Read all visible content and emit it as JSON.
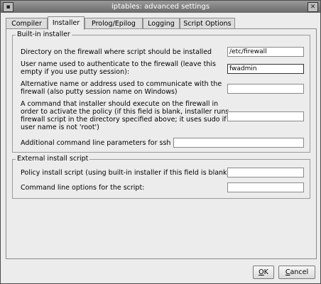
{
  "window": {
    "title": "iptables: advanced settings",
    "menu_icon": "▪",
    "close_icon": "✕"
  },
  "tabs": [
    {
      "label": "Compiler"
    },
    {
      "label": "Installer"
    },
    {
      "label": "Prolog/Epilog"
    },
    {
      "label": "Logging"
    },
    {
      "label": "Script Options"
    }
  ],
  "builtin": {
    "title": "Built-in installer",
    "dir_label": "Directory on the firewall where script should be installed",
    "dir_value": "/etc/firewall",
    "user_label_1": "User name used to authenticate to the firewall (leave this",
    "user_label_2": "empty if you use putty session):",
    "user_value": "fwadmin",
    "alt_label_1": "Alternative name or address used to communicate with the",
    "alt_label_2": "firewall (also putty session name on Windows)",
    "alt_value": "",
    "cmd_label_1": "A command that installer should execute on the firewall in",
    "cmd_label_2": "order to activate the policy (if this field is blank, installer runs",
    "cmd_label_3": "firewall script in the directory specified above; it uses sudo if",
    "cmd_label_4": "user name is not 'root')",
    "cmd_value": "",
    "ssh_label": "Additional command line parameters for ssh",
    "ssh_value": ""
  },
  "external": {
    "title": "External install script",
    "policy_label": "Policy install script (using built-in installer if this field is blank):",
    "policy_value": "",
    "options_label": "Command line options for the script:",
    "options_value": ""
  },
  "buttons": {
    "ok_mnemonic": "O",
    "ok_rest": "K",
    "cancel_mnemonic": "C",
    "cancel_rest": "ancel"
  }
}
